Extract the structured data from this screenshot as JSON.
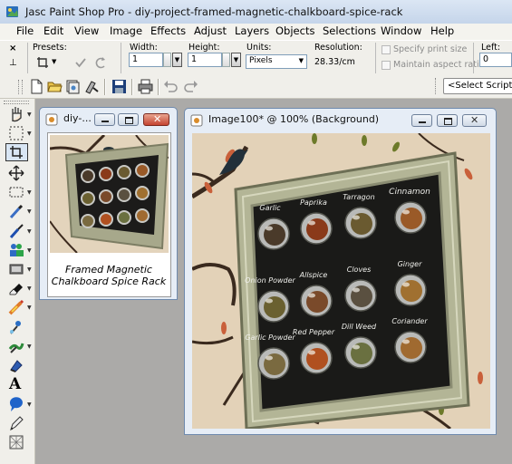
{
  "app": {
    "title": "Jasc Paint Shop Pro - diy-project-framed-magnetic-chalkboard-spice-rack"
  },
  "menu": [
    "File",
    "Edit",
    "View",
    "Image",
    "Effects",
    "Adjust",
    "Layers",
    "Objects",
    "Selections",
    "Window",
    "Help"
  ],
  "options": {
    "presets_label": "Presets:",
    "width_label": "Width:",
    "width_value": "1",
    "height_label": "Height:",
    "height_value": "1",
    "units_label": "Units:",
    "units_value": "Pixels",
    "resolution_label": "Resolution:",
    "resolution_value": "28.33/cm",
    "specify_print_size": "Specify print size",
    "maintain_aspect_ratio": "Maintain aspect ratio",
    "left_label": "Left:",
    "left_value": "0"
  },
  "toolbar": {
    "script_select": "<Select Script"
  },
  "windows": {
    "small": {
      "title": "diy-...",
      "caption_line1": "Framed Magnetic",
      "caption_line2": "Chalkboard Spice Rack"
    },
    "main": {
      "title": "Image100* @ 100% (Background)",
      "jar_labels": [
        "Garlic",
        "Paprika",
        "Tarragon",
        "Cinnamon",
        "Onion Powder",
        "Allspice",
        "Cloves",
        "Ginger",
        "Garlic Powder",
        "Red Pepper",
        "Dill Weed",
        "Coriander"
      ]
    },
    "thumb": {
      "jar_colors": [
        "#4a3a2a",
        "#8a3a1a",
        "#6a5a30",
        "#9a5a28",
        "#6a6030",
        "#7a4a2a",
        "#5a5040",
        "#a07030",
        "#7a6a40",
        "#b05020",
        "#6a7040",
        "#a06a30"
      ]
    }
  },
  "icons": [
    "app-icon",
    "new-icon",
    "open-icon",
    "browse-icon",
    "save-as-icon",
    "save-icon",
    "print-icon",
    "undo-icon",
    "redo-icon",
    "pan-tool-icon",
    "zoom-tool-icon",
    "crop-tool-icon",
    "move-tool-icon",
    "selection-tool-icon",
    "dropper-icon",
    "paint-brush-icon",
    "clone-brush-icon",
    "scratch-remover-icon",
    "eraser-icon",
    "picture-tube-icon",
    "retouch-icon",
    "color-replacer-icon",
    "text-tool-icon",
    "preset-shape-icon",
    "pen-tool-icon",
    "mesh-warp-icon"
  ]
}
